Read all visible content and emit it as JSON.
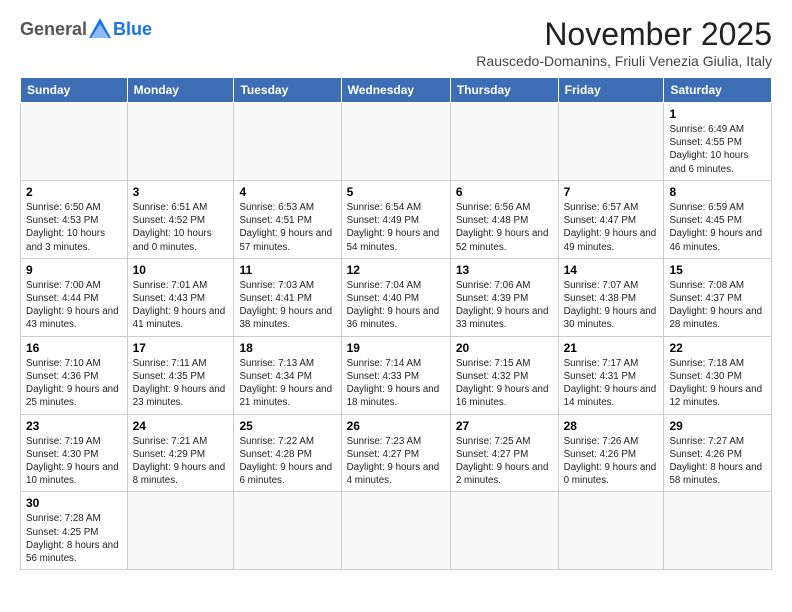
{
  "header": {
    "logo_general": "General",
    "logo_blue": "Blue",
    "month_title": "November 2025",
    "subtitle": "Rauscedo-Domanins, Friuli Venezia Giulia, Italy"
  },
  "weekdays": [
    "Sunday",
    "Monday",
    "Tuesday",
    "Wednesday",
    "Thursday",
    "Friday",
    "Saturday"
  ],
  "weeks": [
    [
      {
        "day": "",
        "info": ""
      },
      {
        "day": "",
        "info": ""
      },
      {
        "day": "",
        "info": ""
      },
      {
        "day": "",
        "info": ""
      },
      {
        "day": "",
        "info": ""
      },
      {
        "day": "",
        "info": ""
      },
      {
        "day": "1",
        "info": "Sunrise: 6:49 AM\nSunset: 4:55 PM\nDaylight: 10 hours and 6 minutes."
      }
    ],
    [
      {
        "day": "2",
        "info": "Sunrise: 6:50 AM\nSunset: 4:53 PM\nDaylight: 10 hours and 3 minutes."
      },
      {
        "day": "3",
        "info": "Sunrise: 6:51 AM\nSunset: 4:52 PM\nDaylight: 10 hours and 0 minutes."
      },
      {
        "day": "4",
        "info": "Sunrise: 6:53 AM\nSunset: 4:51 PM\nDaylight: 9 hours and 57 minutes."
      },
      {
        "day": "5",
        "info": "Sunrise: 6:54 AM\nSunset: 4:49 PM\nDaylight: 9 hours and 54 minutes."
      },
      {
        "day": "6",
        "info": "Sunrise: 6:56 AM\nSunset: 4:48 PM\nDaylight: 9 hours and 52 minutes."
      },
      {
        "day": "7",
        "info": "Sunrise: 6:57 AM\nSunset: 4:47 PM\nDaylight: 9 hours and 49 minutes."
      },
      {
        "day": "8",
        "info": "Sunrise: 6:59 AM\nSunset: 4:45 PM\nDaylight: 9 hours and 46 minutes."
      }
    ],
    [
      {
        "day": "9",
        "info": "Sunrise: 7:00 AM\nSunset: 4:44 PM\nDaylight: 9 hours and 43 minutes."
      },
      {
        "day": "10",
        "info": "Sunrise: 7:01 AM\nSunset: 4:43 PM\nDaylight: 9 hours and 41 minutes."
      },
      {
        "day": "11",
        "info": "Sunrise: 7:03 AM\nSunset: 4:41 PM\nDaylight: 9 hours and 38 minutes."
      },
      {
        "day": "12",
        "info": "Sunrise: 7:04 AM\nSunset: 4:40 PM\nDaylight: 9 hours and 36 minutes."
      },
      {
        "day": "13",
        "info": "Sunrise: 7:06 AM\nSunset: 4:39 PM\nDaylight: 9 hours and 33 minutes."
      },
      {
        "day": "14",
        "info": "Sunrise: 7:07 AM\nSunset: 4:38 PM\nDaylight: 9 hours and 30 minutes."
      },
      {
        "day": "15",
        "info": "Sunrise: 7:08 AM\nSunset: 4:37 PM\nDaylight: 9 hours and 28 minutes."
      }
    ],
    [
      {
        "day": "16",
        "info": "Sunrise: 7:10 AM\nSunset: 4:36 PM\nDaylight: 9 hours and 25 minutes."
      },
      {
        "day": "17",
        "info": "Sunrise: 7:11 AM\nSunset: 4:35 PM\nDaylight: 9 hours and 23 minutes."
      },
      {
        "day": "18",
        "info": "Sunrise: 7:13 AM\nSunset: 4:34 PM\nDaylight: 9 hours and 21 minutes."
      },
      {
        "day": "19",
        "info": "Sunrise: 7:14 AM\nSunset: 4:33 PM\nDaylight: 9 hours and 18 minutes."
      },
      {
        "day": "20",
        "info": "Sunrise: 7:15 AM\nSunset: 4:32 PM\nDaylight: 9 hours and 16 minutes."
      },
      {
        "day": "21",
        "info": "Sunrise: 7:17 AM\nSunset: 4:31 PM\nDaylight: 9 hours and 14 minutes."
      },
      {
        "day": "22",
        "info": "Sunrise: 7:18 AM\nSunset: 4:30 PM\nDaylight: 9 hours and 12 minutes."
      }
    ],
    [
      {
        "day": "23",
        "info": "Sunrise: 7:19 AM\nSunset: 4:30 PM\nDaylight: 9 hours and 10 minutes."
      },
      {
        "day": "24",
        "info": "Sunrise: 7:21 AM\nSunset: 4:29 PM\nDaylight: 9 hours and 8 minutes."
      },
      {
        "day": "25",
        "info": "Sunrise: 7:22 AM\nSunset: 4:28 PM\nDaylight: 9 hours and 6 minutes."
      },
      {
        "day": "26",
        "info": "Sunrise: 7:23 AM\nSunset: 4:27 PM\nDaylight: 9 hours and 4 minutes."
      },
      {
        "day": "27",
        "info": "Sunrise: 7:25 AM\nSunset: 4:27 PM\nDaylight: 9 hours and 2 minutes."
      },
      {
        "day": "28",
        "info": "Sunrise: 7:26 AM\nSunset: 4:26 PM\nDaylight: 9 hours and 0 minutes."
      },
      {
        "day": "29",
        "info": "Sunrise: 7:27 AM\nSunset: 4:26 PM\nDaylight: 8 hours and 58 minutes."
      }
    ],
    [
      {
        "day": "30",
        "info": "Sunrise: 7:28 AM\nSunset: 4:25 PM\nDaylight: 8 hours and 56 minutes."
      },
      {
        "day": "",
        "info": ""
      },
      {
        "day": "",
        "info": ""
      },
      {
        "day": "",
        "info": ""
      },
      {
        "day": "",
        "info": ""
      },
      {
        "day": "",
        "info": ""
      },
      {
        "day": "",
        "info": ""
      }
    ]
  ]
}
